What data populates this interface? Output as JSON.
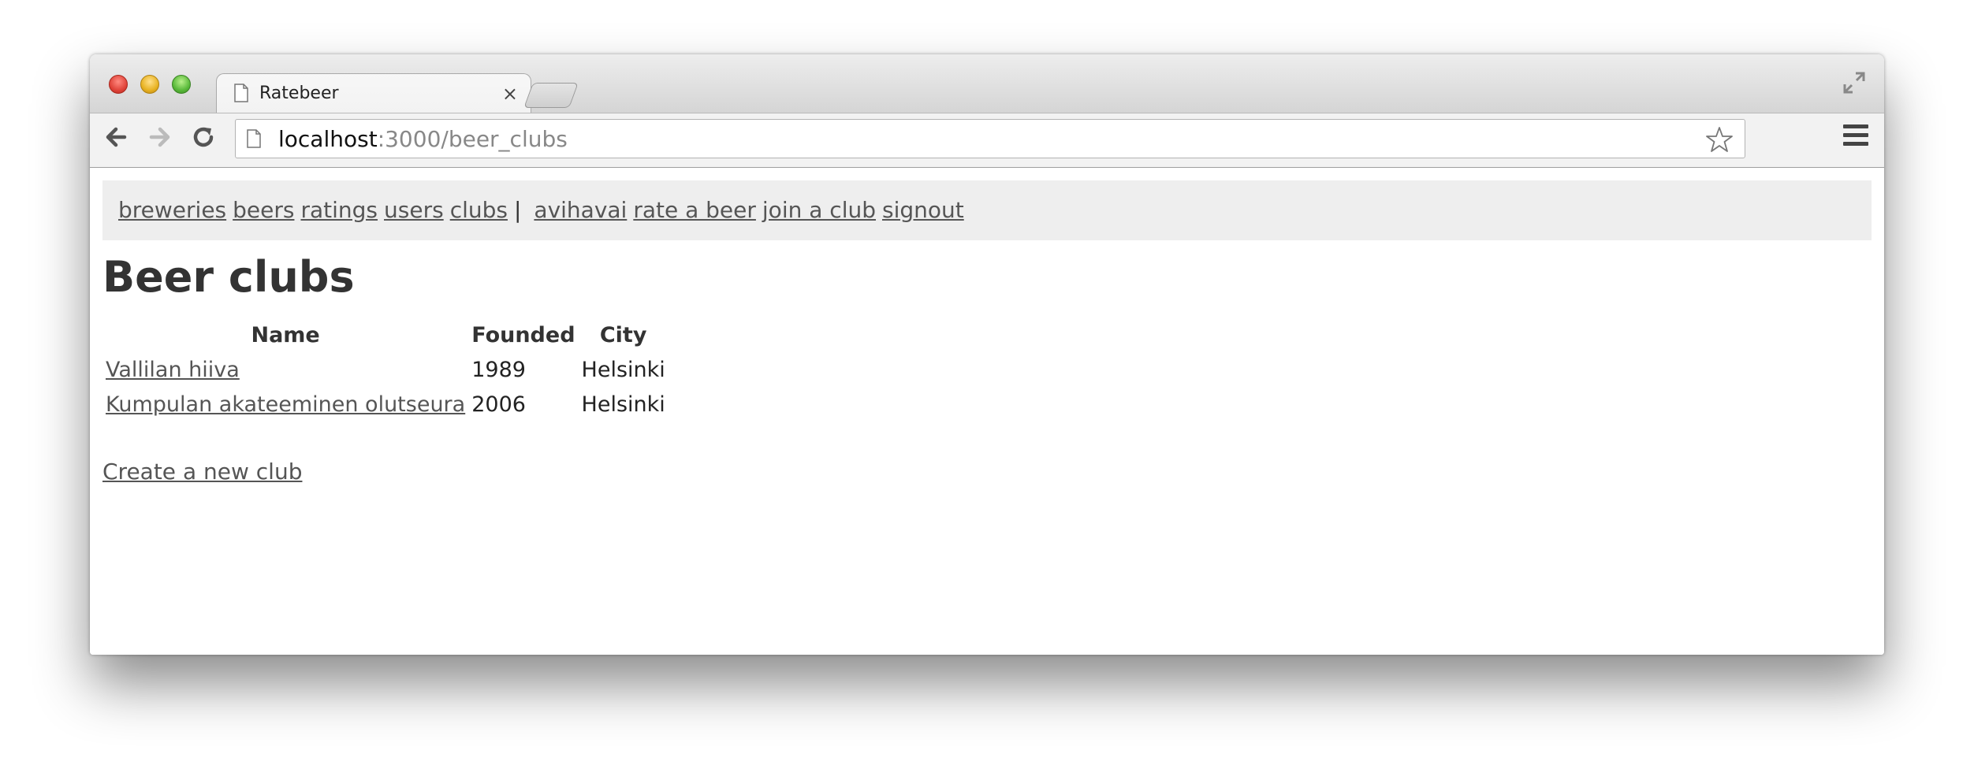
{
  "browser": {
    "tab_title": "Ratebeer",
    "tab_close": "×",
    "url_host": "localhost",
    "url_rest": ":3000/beer_clubs"
  },
  "nav": {
    "links": [
      "breweries",
      "beers",
      "ratings",
      "users",
      "clubs"
    ],
    "separator": "|",
    "user_links": [
      "avihavai",
      "rate a beer",
      "join a club",
      "signout"
    ]
  },
  "page": {
    "title": "Beer clubs",
    "table": {
      "headers": [
        "Name",
        "Founded",
        "City"
      ],
      "rows": [
        {
          "name": "Vallilan hiiva",
          "founded": "1989",
          "city": "Helsinki"
        },
        {
          "name": "Kumpulan akateeminen olutseura",
          "founded": "2006",
          "city": "Helsinki"
        }
      ]
    },
    "create_link": "Create a new club"
  },
  "icons": {
    "back": "arrow-left-icon",
    "forward": "arrow-right-icon",
    "reload": "reload-icon",
    "bookmark": "star-icon",
    "menu": "hamburger-menu-icon",
    "fullscreen": "fullscreen-icon",
    "page": "document-icon"
  },
  "colors": {
    "navbar_bg": "#eeeeee",
    "link": "#555555",
    "heading": "#333333"
  }
}
